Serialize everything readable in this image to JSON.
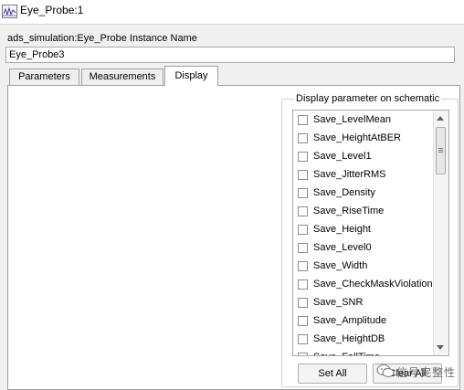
{
  "window": {
    "title": "Eye_Probe:1"
  },
  "instance": {
    "label": "ads_simulation:Eye_Probe Instance Name",
    "value": "Eye_Probe3"
  },
  "tabs": [
    {
      "label": "Parameters",
      "active": false
    },
    {
      "label": "Measurements",
      "active": false
    },
    {
      "label": "Display",
      "active": true
    }
  ],
  "display": {
    "group_title": "Display parameter on schematic",
    "items": [
      {
        "label": "Save_LevelMean",
        "checked": false
      },
      {
        "label": "Save_HeightAtBER",
        "checked": false
      },
      {
        "label": "Save_Level1",
        "checked": false
      },
      {
        "label": "Save_JitterRMS",
        "checked": false
      },
      {
        "label": "Save_Density",
        "checked": false
      },
      {
        "label": "Save_RiseTime",
        "checked": false
      },
      {
        "label": "Save_Height",
        "checked": false
      },
      {
        "label": "Save_Level0",
        "checked": false
      },
      {
        "label": "Save_Width",
        "checked": false
      },
      {
        "label": "Save_CheckMaskViolation",
        "checked": false
      },
      {
        "label": "Save_SNR",
        "checked": false
      },
      {
        "label": "Save_Amplitude",
        "checked": false
      },
      {
        "label": "Save_HeightDB",
        "checked": false
      },
      {
        "label": "Save_FallTime",
        "checked": false
      }
    ],
    "set_all_label": "Set All",
    "clear_all_label": "Clear All"
  },
  "watermark": {
    "text": "信号完整性",
    "icon": "wechat-icon"
  },
  "icons": {
    "app": "ads-app-icon"
  },
  "colors": {
    "background": "#f0f0f0",
    "panel": "#ffffff",
    "border": "#a0a0a0"
  }
}
